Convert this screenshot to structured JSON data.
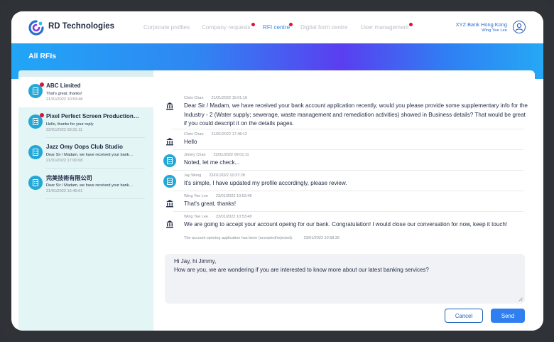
{
  "header": {
    "brand": "RD Technologies",
    "nav": [
      {
        "label": "Corporate profiles",
        "active": false,
        "dot": false
      },
      {
        "label": "Company requests",
        "active": false,
        "dot": true
      },
      {
        "label": "RFI centre",
        "active": true,
        "dot": true
      },
      {
        "label": "Digital form centre",
        "active": false,
        "dot": false
      },
      {
        "label": "User management",
        "active": false,
        "dot": true
      }
    ],
    "bank_name": "XYZ Bank Hong Kong",
    "user_name": "Wing Yee Lee"
  },
  "banner": {
    "title": "All RFIs"
  },
  "rfi_list": [
    {
      "title": "ABC Limited",
      "preview": "That's great, thanks!",
      "time": "21/01/2022  10:53:48",
      "unread": true,
      "selected": true
    },
    {
      "title": "Pixel Perfect Screen Production…",
      "preview": "Hello, thanks for your reply",
      "time": "22/01/2022  09:01:11",
      "unread": true,
      "selected": false
    },
    {
      "title": "Jazz Omy Oops Club Studio",
      "preview": "Dear Sir / Madam, we have received your bank…",
      "time": "21/01/2022  17:00:08",
      "unread": false,
      "selected": false
    },
    {
      "title": "完美技術有限公司",
      "preview": "Dear Sir / Madam, we have received your bank…",
      "time": "21/01/2022  16:46:01",
      "unread": false,
      "selected": false
    }
  ],
  "messages": [
    {
      "sender": "Chris Chan",
      "time": "21/01/2022  15:01:19",
      "icon": "bank-icon",
      "text": "Dear Sir / Madam, we have received your bank account application recently, would you please provide some supplementary info for the Industry - 2 (Water supply; sewerage, waste management and remediation activities) showed in Business details? That would be great if you could descript it on the details pages."
    },
    {
      "sender": "Chris Chan",
      "time": "21/01/2022  17:48:12",
      "icon": "bank-icon",
      "text": "Hello"
    },
    {
      "sender": "Jimmy Chan",
      "time": "22/01/2022  09:01:11",
      "icon": "company-icon",
      "text": "Noted, let me check..."
    },
    {
      "sender": "Jay Wong",
      "time": "23/01/2022  10:37:28",
      "icon": "company-icon",
      "text": "It's simple, I have updated my profile accordingly, please review."
    },
    {
      "sender": "Wing Yee Lee",
      "time": "23/01/2022  10:53:48",
      "icon": "bank-icon",
      "text": "That's great, thanks!"
    },
    {
      "sender": "Wing Yee Lee",
      "time": "23/01/2022  10:53:48",
      "icon": "bank-icon",
      "text": "We are going to accept your account opeing for our bank. Congratulation! I would close our conversation for now, keep it touch!"
    }
  ],
  "system_note": {
    "text": "The account opening application has been (accepted/rejected).",
    "time": "23/01/2022  10:58:36"
  },
  "composer": {
    "value": "Hi Jay, hi Jimmy,\nHow are you, we are wondering if you are interested to know more about our latest banking services?"
  },
  "actions": {
    "cancel": "Cancel",
    "send": "Send"
  },
  "colors": {
    "accent": "#2f7ff0",
    "unread_dot": "#e0123c",
    "company_icon": "#23a7d6",
    "list_bg": "#e4f5f6"
  }
}
